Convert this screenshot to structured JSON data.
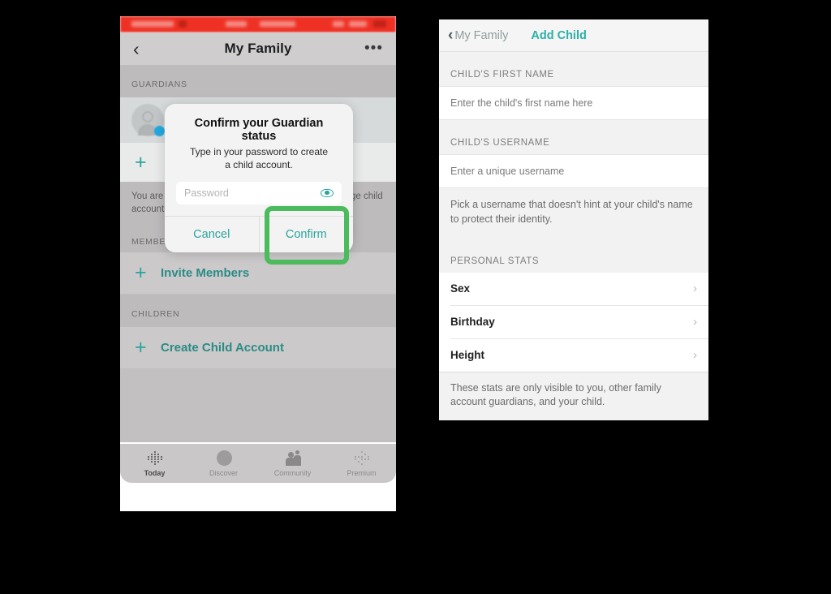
{
  "colors": {
    "teal": "#2aa49d",
    "teal_dark": "#2b8c85",
    "highlight_green": "#4cbb5d",
    "status_red": "#ee3124",
    "badge_blue": "#22a9e0"
  },
  "left_phone": {
    "navbar": {
      "back_icon": "chevron-left-icon",
      "title": "My Family",
      "more_icon": "ellipsis-icon"
    },
    "sections": {
      "guardians_label": "GUARDIANS",
      "members_label": "MEMBERS",
      "children_label": "CHILDREN"
    },
    "add_guardian_label": "",
    "note": "You are a Guardian. Guardians can create and manage child accounts.",
    "invite_members_label": "Invite Members",
    "create_child_label": "Create Child Account",
    "tabbar": [
      {
        "label": "Today",
        "icon": "today-dots-icon",
        "active": true
      },
      {
        "label": "Discover",
        "icon": "compass-icon",
        "active": false
      },
      {
        "label": "Community",
        "icon": "community-people-icon",
        "active": false
      },
      {
        "label": "Premium",
        "icon": "premium-dots-icon",
        "active": false
      }
    ],
    "dialog": {
      "title": "Confirm your Guardian status",
      "subtitle": "Type in your password to create a child account.",
      "password_placeholder": "Password",
      "password_value": "",
      "reveal_icon": "eye-icon",
      "cancel_label": "Cancel",
      "confirm_label": "Confirm"
    }
  },
  "right_phone": {
    "navbar": {
      "back_icon": "chevron-left-icon",
      "back_label": "My Family",
      "title": "Add Child"
    },
    "first_name": {
      "section_label": "CHILD'S FIRST NAME",
      "placeholder": "Enter the child's first name here",
      "value": ""
    },
    "username": {
      "section_label": "CHILD'S USERNAME",
      "placeholder": "Enter a unique username",
      "value": "",
      "hint": "Pick a username that doesn't hint at your child's name to protect their identity."
    },
    "personal_stats": {
      "section_label": "PERSONAL STATS",
      "rows": [
        {
          "label": "Sex",
          "chevron": "chevron-right-icon"
        },
        {
          "label": "Birthday",
          "chevron": "chevron-right-icon"
        },
        {
          "label": "Height",
          "chevron": "chevron-right-icon"
        }
      ],
      "footnote": "These stats are only visible to you, other family account guardians, and your child."
    }
  }
}
